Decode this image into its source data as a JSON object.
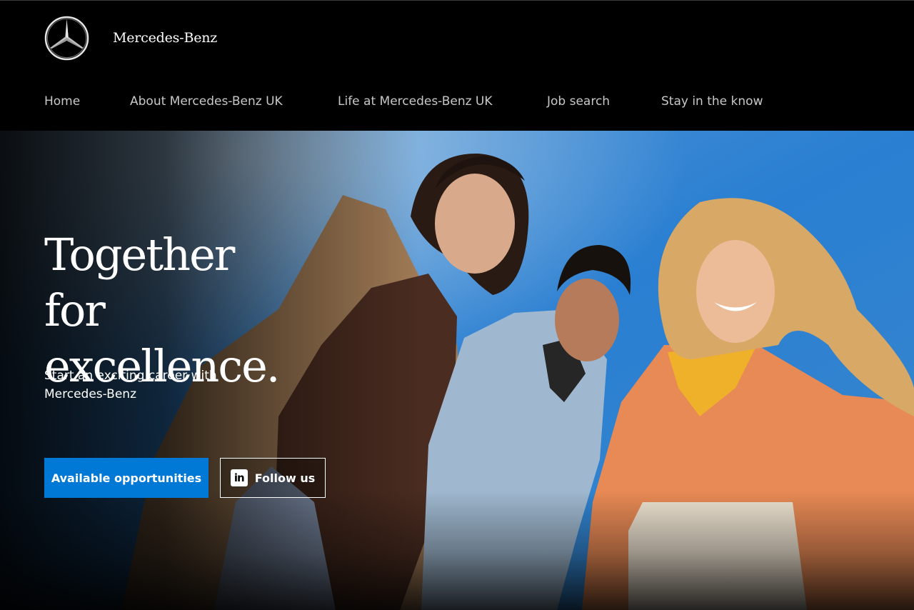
{
  "brand": {
    "name": "Mercedes-Benz",
    "logo_icon": "mercedes-star-icon"
  },
  "nav": {
    "items": [
      {
        "label": "Home"
      },
      {
        "label": "About Mercedes-Benz UK"
      },
      {
        "label": "Life at Mercedes-Benz UK"
      },
      {
        "label": "Job search"
      },
      {
        "label": "Stay in the know"
      }
    ]
  },
  "hero": {
    "title_line1": "Together for",
    "title_line2": "excellence.",
    "subtitle": "Start an exciting career with Mercedes-Benz",
    "primary_button": "Available opportunities",
    "secondary_button": "Follow us",
    "secondary_icon": "linkedin-icon",
    "linkedin_glyph": "in"
  },
  "colors": {
    "header_bg": "#000000",
    "nav_text": "#c8c8c8",
    "primary_button": "#0078d6",
    "sky": "#2a7ed0"
  }
}
